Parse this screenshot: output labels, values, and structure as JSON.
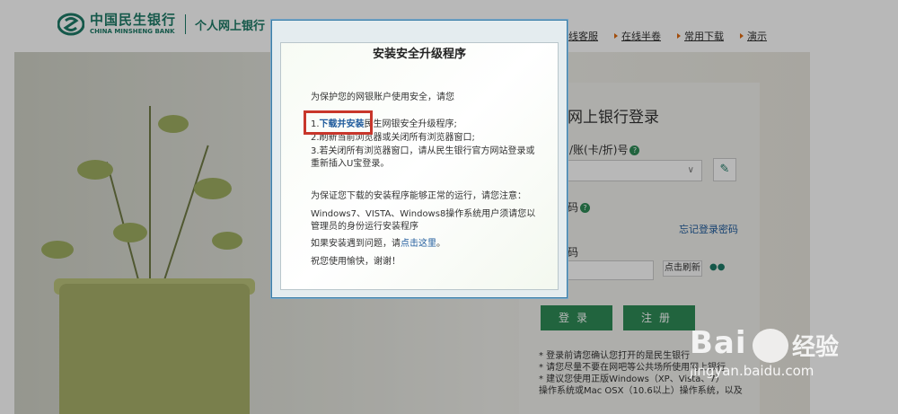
{
  "header": {
    "bank_name_cn": "中国民生银行",
    "bank_name_en": "CHINA MINSHENG BANK",
    "subtitle": "个人网上银行",
    "links": [
      "在线客服",
      "在线半卷",
      "常用下载",
      "演示"
    ]
  },
  "login": {
    "title": "网上银行登录",
    "account_label": "名/账(卡/折)号",
    "password_label": "码",
    "forgot_label": "忘记登录密码",
    "captcha_label": "码",
    "refresh_label": "点击刷新",
    "login_button": "登录",
    "register_button": "注册",
    "notes": [
      "* 登录前请您确认您打开的是民生银行",
      "* 请您尽量不要在网吧等公共场所使用网上银行",
      "* 建议您使用正版Windows（XP、Vista、7）",
      "操作系统或Mac OSX（10.6以上）操作系统，以及"
    ]
  },
  "dialog": {
    "title": "安装安全升级程序",
    "intro": "为保护您的网银账户使用安全，请您",
    "step1_prefix": "1.",
    "step1_link": "下载并安装",
    "step1_suffix": "民生网银安全升级程序;",
    "step2": "2.刷新当前浏览器或关闭所有浏览器窗口;",
    "step3a": "3.若关闭所有浏览器窗口，请从民生银行官方网站登录或",
    "step3b": "重新插入U宝登录。",
    "note_intro": "为保证您下载的安装程序能够正常的运行，请您注意：",
    "note_line1": "Windows7、VISTA、Windows8操作系统用户须请您以",
    "note_line2": "管理员的身份运行安装程序",
    "help_prefix": "如果安装遇到问题，请",
    "help_link": "点击这里",
    "help_suffix": "。",
    "closing": "祝您使用愉快，谢谢！"
  },
  "watermark": {
    "brand": "Bai",
    "brand2": "经验",
    "url": "jingyan.baidu.com"
  }
}
